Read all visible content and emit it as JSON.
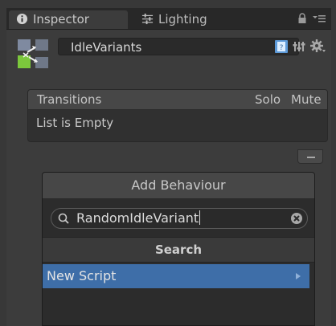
{
  "tabs": {
    "inspector_label": "Inspector",
    "lighting_label": "Lighting"
  },
  "header": {
    "state_name": "IdleVariants"
  },
  "transitions": {
    "title": "Transitions",
    "solo_label": "Solo",
    "mute_label": "Mute",
    "empty_text": "List is Empty"
  },
  "add_behaviour": {
    "title": "Add Behaviour",
    "search_value": "RandomIdleVariant",
    "section_label": "Search",
    "items": [
      {
        "label": "New Script"
      }
    ]
  },
  "icons": {
    "inspector": "info-circle-icon",
    "lighting": "sliders-icon",
    "lock": "lock-icon",
    "menu": "context-menu-icon",
    "state": "animator-state-icon",
    "help": "help-book-icon",
    "preset": "preset-icon",
    "gear": "gear-icon",
    "search": "search-icon",
    "clear": "clear-circle-icon",
    "arrow": "chevron-right-icon"
  },
  "colors": {
    "panel": "#3c3c3c",
    "selection": "#3e6ea8",
    "state_green": "#7cc83c"
  }
}
